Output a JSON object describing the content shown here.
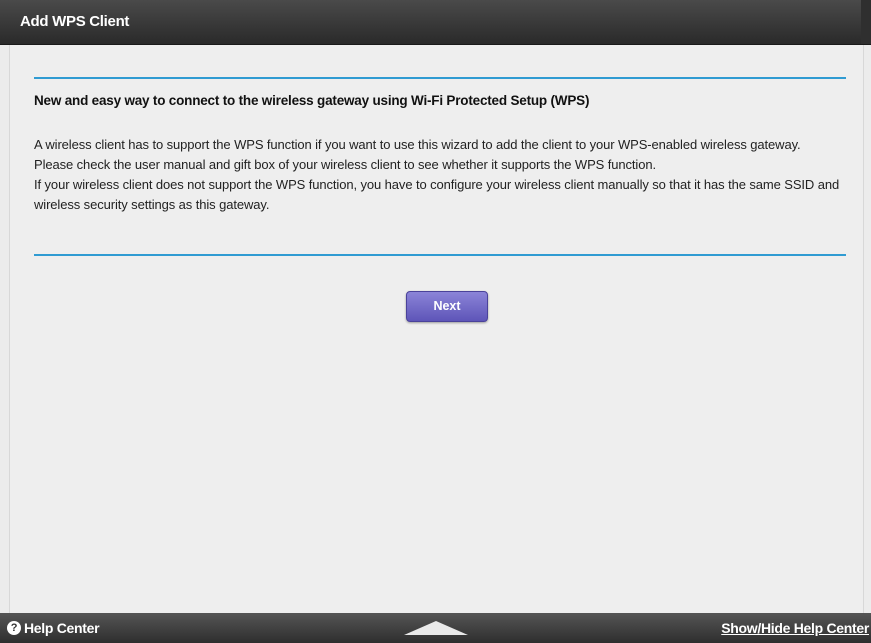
{
  "window": {
    "title": "Add WPS Client"
  },
  "main": {
    "heading": "New and easy way to connect to the wireless gateway using Wi-Fi Protected Setup (WPS)",
    "paragraphs": [
      "A wireless client has to support the WPS function if you want to use this wizard to add the client to your WPS-enabled wireless gateway.",
      "Please check the user manual and gift box of your wireless client to see whether it supports the WPS function.",
      "If your wireless client does not support the WPS function, you have to configure your wireless client manually so that it has the same SSID and wireless security settings as this gateway."
    ],
    "next_label": "Next"
  },
  "footer": {
    "help_icon": "question-circle-icon",
    "help_label": "Help Center",
    "arrow_icon": "triangle-up-icon",
    "toggle_label": "Show/Hide Help Center"
  },
  "colors": {
    "accent_rule": "#2f9bd2",
    "button": "#6f67c8",
    "title_bar": "#333333"
  }
}
